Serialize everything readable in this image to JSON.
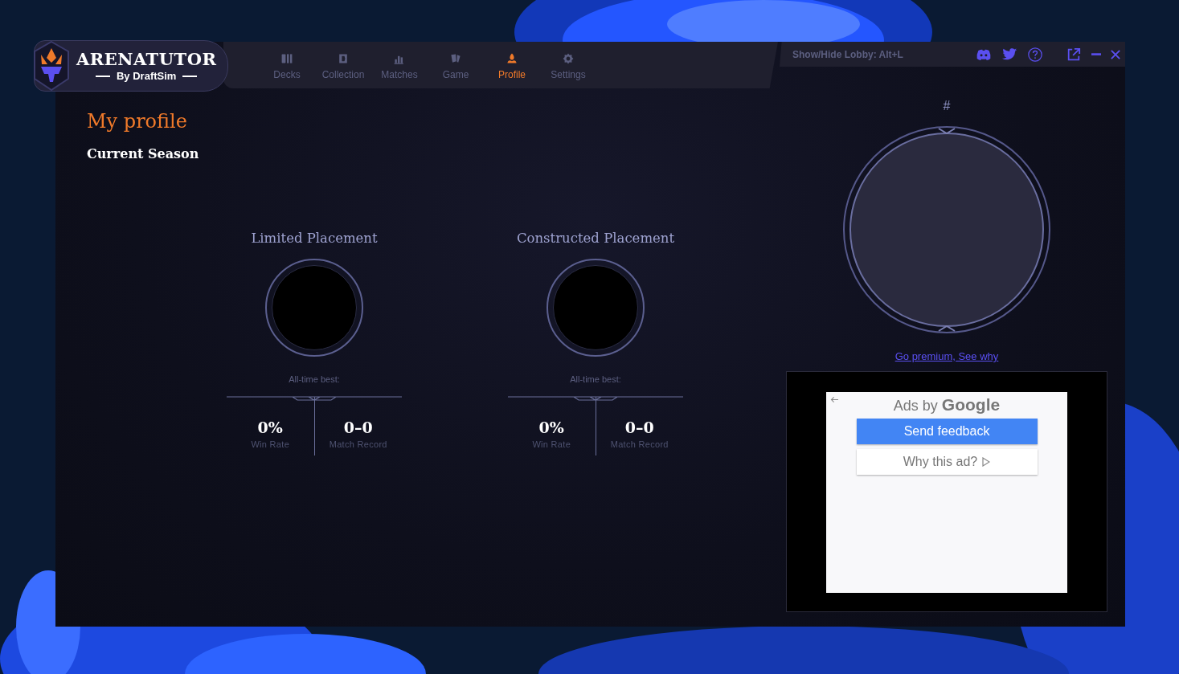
{
  "logo": {
    "title": "ARENATUTOR",
    "subtitle": "By DraftSim"
  },
  "nav": [
    {
      "label": "Decks",
      "kind": "decks",
      "selected": false
    },
    {
      "label": "Collection",
      "kind": "collection",
      "selected": false
    },
    {
      "label": "Matches",
      "kind": "matches",
      "selected": false
    },
    {
      "label": "Game",
      "kind": "game",
      "selected": false
    },
    {
      "label": "Profile",
      "kind": "profile",
      "selected": true
    },
    {
      "label": "Settings",
      "kind": "settings",
      "selected": false
    }
  ],
  "lobby_hint": "Show/Hide Lobby: Alt+L",
  "profile": {
    "title": "My profile",
    "season": "Current Season"
  },
  "placements": [
    {
      "title": "Limited Placement",
      "best_label": "All-time best:",
      "stats": [
        {
          "value": "0%",
          "label": "Win Rate"
        },
        {
          "value": "0–0",
          "label": "Match Record"
        }
      ]
    },
    {
      "title": "Constructed Placement",
      "best_label": "All-time best:",
      "stats": [
        {
          "value": "0%",
          "label": "Win Rate"
        },
        {
          "value": "0–0",
          "label": "Match Record"
        }
      ]
    }
  ],
  "rank": {
    "number": "#",
    "link": "Go premium, See why"
  },
  "ad": {
    "heading": "Ads by **Google**",
    "buttons": [
      {
        "label": "Send feedback",
        "kind": "primary"
      },
      {
        "label": "Why this ad?",
        "kind": "secondary"
      }
    ]
  }
}
